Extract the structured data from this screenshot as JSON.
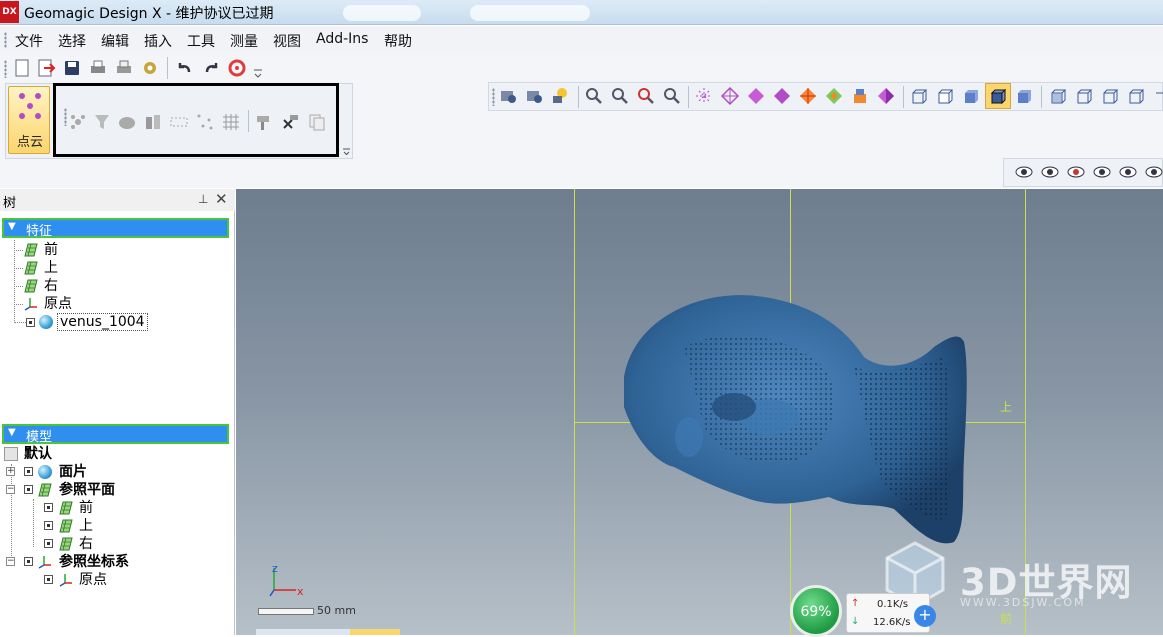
{
  "window": {
    "title": "Geomagic Design X - 维护协议已过期",
    "logo_text": "DX"
  },
  "menu": {
    "items": [
      "文件",
      "选择",
      "编辑",
      "插入",
      "工具",
      "测量",
      "视图",
      "Add-Ins",
      "帮助"
    ]
  },
  "ribbon": {
    "point_cloud_label": "点云"
  },
  "tree": {
    "title": "树",
    "feature_group": "特征",
    "features": [
      "前",
      "上",
      "右",
      "原点",
      "venus_1004"
    ],
    "model_group": "模型",
    "model_rows": {
      "default": "默认",
      "mesh": "面片",
      "ref_planes": "参照平面",
      "plane_front": "前",
      "plane_top": "上",
      "plane_right": "右",
      "ref_coord": "参照坐标系",
      "origin": "原点"
    }
  },
  "viewport": {
    "plane_label_top": "上",
    "plane_label_front": "前",
    "axis_z": "z",
    "axis_x": "x",
    "scale_text": "50 mm"
  },
  "tray": {
    "percent": "69%",
    "upload": "0.1K/s",
    "download": "12.6K/s"
  },
  "watermark": {
    "title": "3D世界网",
    "url": "WWW.3DSJW.COM"
  },
  "colors": {
    "accent": "#2f8ff0",
    "guide": "#c9e24a",
    "model": "#3d6f9e"
  }
}
